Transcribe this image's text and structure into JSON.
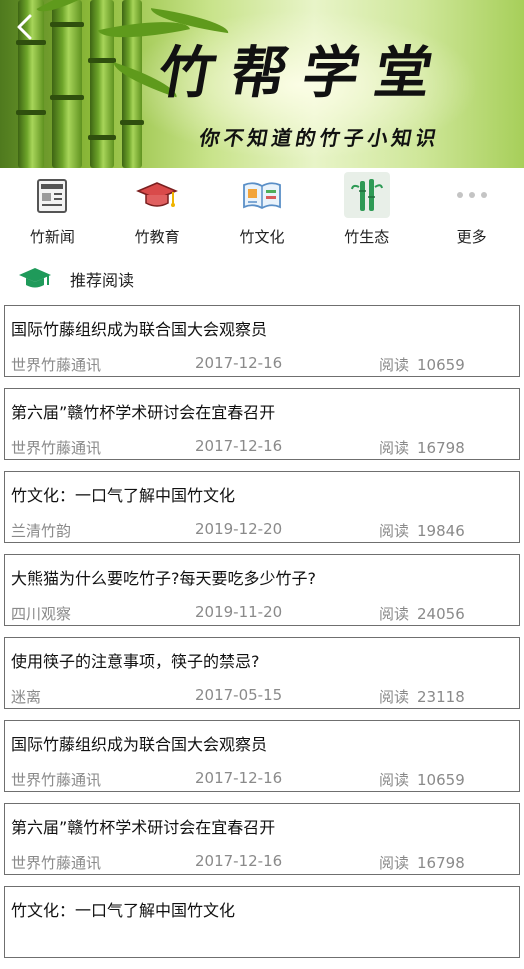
{
  "banner": {
    "title": "竹帮学堂",
    "subtitle": "你不知道的竹子小知识"
  },
  "nav": [
    {
      "label": "竹新闻",
      "icon": "newspaper-icon"
    },
    {
      "label": "竹教育",
      "icon": "graduation-cap-icon"
    },
    {
      "label": "竹文化",
      "icon": "open-book-icon"
    },
    {
      "label": "竹生态",
      "icon": "bamboo-icon"
    },
    {
      "label": "更多",
      "icon": "more-dots-icon"
    }
  ],
  "section": {
    "title": "推荐阅读",
    "accent": "#1f9a5a"
  },
  "articles": [
    {
      "title": "国际竹藤组织成为联合国大会观察员",
      "source": "世界竹藤通讯",
      "date": "2017-12-16",
      "reads_label": "阅读",
      "reads": "10659"
    },
    {
      "title": "第六届”赣竹杯学术研讨会在宜春召开",
      "source": "世界竹藤通讯",
      "date": "2017-12-16",
      "reads_label": "阅读",
      "reads": "16798"
    },
    {
      "title": "竹文化：一口气了解中国竹文化",
      "source": "兰清竹韵",
      "date": "2019-12-20",
      "reads_label": "阅读",
      "reads": "19846"
    },
    {
      "title": "大熊猫为什么要吃竹子?每天要吃多少竹子?",
      "source": "四川观察",
      "date": "2019-11-20",
      "reads_label": "阅读",
      "reads": "24056"
    },
    {
      "title": "使用筷子的注意事项，筷子的禁忌?",
      "source": "迷离",
      "date": "2017-05-15",
      "reads_label": "阅读",
      "reads": "23118"
    },
    {
      "title": "国际竹藤组织成为联合国大会观察员",
      "source": "世界竹藤通讯",
      "date": "2017-12-16",
      "reads_label": "阅读",
      "reads": "10659"
    },
    {
      "title": "第六届”赣竹杯学术研讨会在宜春召开",
      "source": "世界竹藤通讯",
      "date": "2017-12-16",
      "reads_label": "阅读",
      "reads": "16798"
    },
    {
      "title": "竹文化：一口气了解中国竹文化",
      "source": "",
      "date": "",
      "reads_label": "",
      "reads": ""
    }
  ]
}
